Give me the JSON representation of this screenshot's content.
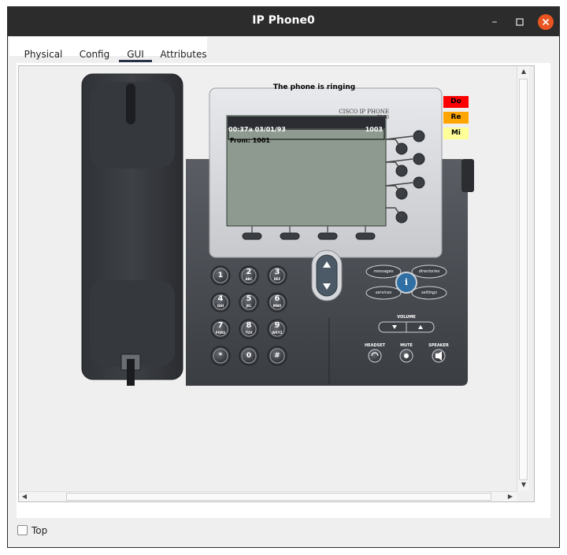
{
  "window": {
    "title": "IP Phone0"
  },
  "window_controls": {
    "minimize": "–",
    "maximize": "☐",
    "close": "✕"
  },
  "tabs": [
    {
      "label": "Physical"
    },
    {
      "label": "Config"
    },
    {
      "label": "GUI"
    },
    {
      "label": "Attributes"
    }
  ],
  "active_tab": "GUI",
  "phone": {
    "status": "The phone is ringing",
    "brand": "CISCO IP PHONE",
    "model": "7960",
    "screen": {
      "time_date": "00:37a 03/01/93",
      "extension": "1003",
      "line": "From: 1001"
    },
    "indicators": [
      {
        "label": "Do",
        "color": "#ff0000"
      },
      {
        "label": "Re",
        "color": "#ffa500"
      },
      {
        "label": "Mi",
        "color": "#ffff99"
      }
    ],
    "keypad": [
      {
        "digit": "1",
        "letters": ""
      },
      {
        "digit": "2",
        "letters": "ABC"
      },
      {
        "digit": "3",
        "letters": "DEF"
      },
      {
        "digit": "4",
        "letters": "GHI"
      },
      {
        "digit": "5",
        "letters": "JKL"
      },
      {
        "digit": "6",
        "letters": "MNO"
      },
      {
        "digit": "7",
        "letters": "PQRS"
      },
      {
        "digit": "8",
        "letters": "TUV"
      },
      {
        "digit": "9",
        "letters": "WXYZ"
      },
      {
        "digit": "*",
        "letters": ""
      },
      {
        "digit": "0",
        "letters": ""
      },
      {
        "digit": "#",
        "letters": ""
      }
    ],
    "function_keys": {
      "messages": "messages",
      "directories": "directories",
      "services": "services",
      "settings": "settings",
      "info": "i"
    },
    "volume_label": "VOLUME",
    "headset_label": "HEADSET",
    "mute_label": "MUTE",
    "speaker_label": "SPEAKER"
  },
  "footer": {
    "top_label": "Top",
    "top_checked": false
  }
}
